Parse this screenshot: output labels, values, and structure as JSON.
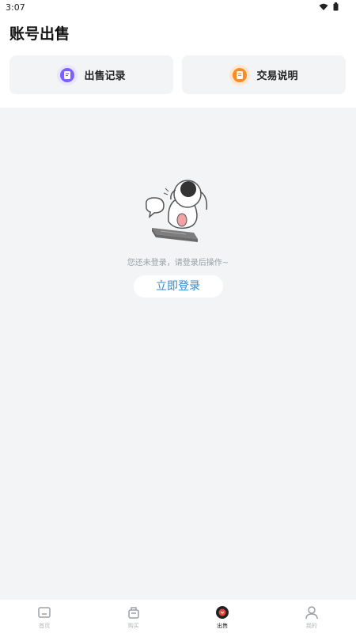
{
  "status_bar": {
    "time": "3:07"
  },
  "header": {
    "title": "账号出售"
  },
  "cards": [
    {
      "label": "出售记录",
      "icon": "sale-record-icon",
      "color": "#7b61ff"
    },
    {
      "label": "交易说明",
      "icon": "trade-note-icon",
      "color": "#ff8a1f"
    }
  ],
  "empty_state": {
    "message": "您还未登录，请登录后操作~",
    "button_label": "立即登录"
  },
  "tabs": [
    {
      "label": "首页",
      "icon": "home-icon",
      "active": false
    },
    {
      "label": "购买",
      "icon": "basket-icon",
      "active": false
    },
    {
      "label": "出售",
      "icon": "sell-icon",
      "active": true
    },
    {
      "label": "我的",
      "icon": "profile-icon",
      "active": false
    }
  ],
  "colors": {
    "accent_blue": "#2d8ad6",
    "background": "#f3f4f6"
  }
}
